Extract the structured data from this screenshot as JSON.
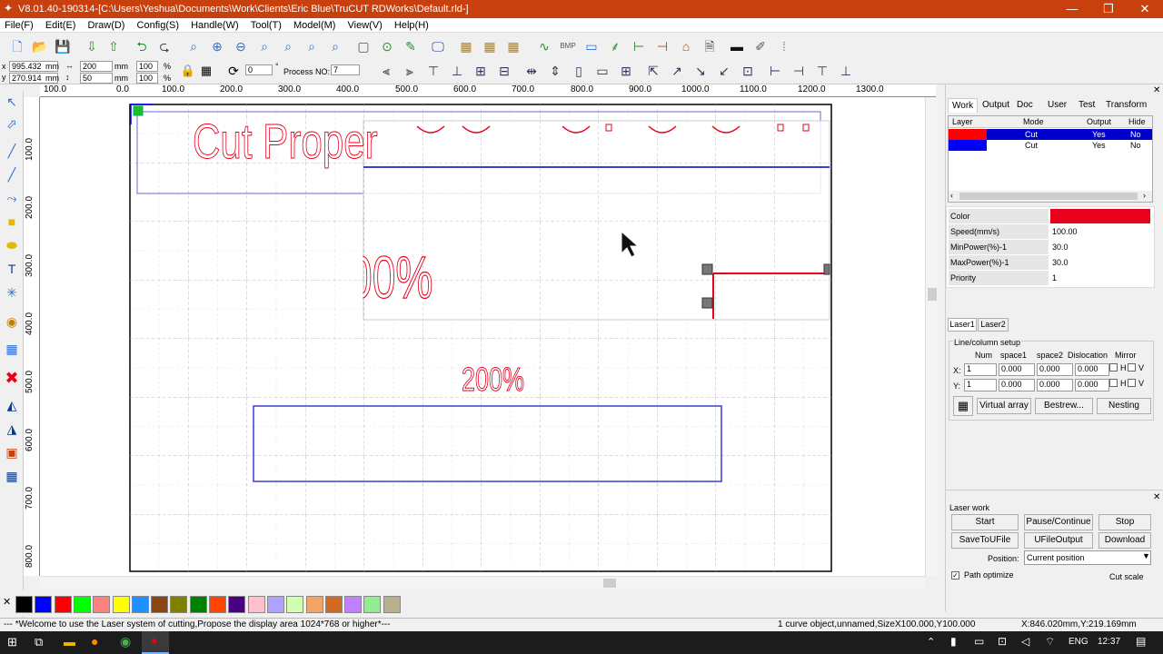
{
  "window": {
    "title": "V8.01.40-190314-[C:\\Users\\Yeshua\\Documents\\Work\\Clients\\Eric Blue\\TruCUT RDWorks\\Default.rld-]",
    "minimize": "—",
    "maximize": "❐",
    "close": "✕"
  },
  "menu": [
    "File(F)",
    "Edit(E)",
    "Draw(D)",
    "Config(S)",
    "Handle(W)",
    "Tool(T)",
    "Model(M)",
    "View(V)",
    "Help(H)"
  ],
  "toolbar2": {
    "x_value": "995.432",
    "y_value": "270.914",
    "x_unit": "mm",
    "y_unit": "mm",
    "width_value": "200",
    "height_value": "50",
    "w_unit": "mm",
    "h_unit": "mm",
    "scale_x": "100",
    "scale_y": "100",
    "pct1": "%",
    "pct2": "%",
    "rotate_value": "0",
    "deg": "°",
    "process_label": "Process NO:",
    "process_value": "7"
  },
  "ruler_h": [
    "100.0",
    "0.0",
    "100.0",
    "200.0",
    "300.0",
    "400.0",
    "500.0",
    "600.0",
    "700.0",
    "800.0",
    "900.0",
    "1000.0",
    "1100.0",
    "1200.0",
    "1300.0"
  ],
  "ruler_v": [
    "100.0",
    "200.0",
    "300.0",
    "400.0",
    "500.0",
    "600.0",
    "700.0",
    "800.0"
  ],
  "canvas": {
    "text_cut_proper": "Cut Proper",
    "text_00pct": "00%",
    "text_200pct": "200%"
  },
  "colors": {
    "accent_red": "#e8001c",
    "accent_blue": "#0000ff",
    "title_bar": "#c9400f",
    "layer_sel": "#0000cc"
  },
  "palette": [
    "#000000",
    "#0000ff",
    "#ff0000",
    "#00ff00",
    "#ff8080",
    "#ffff00",
    "#1e90ff",
    "#8b4513",
    "#808000",
    "#008000",
    "#ff4500",
    "#4b0082",
    "#ffc0cb",
    "#b0a0ff",
    "#d0ffb0",
    "#f4a460",
    "#d2691e",
    "#c080ff",
    "#90ee90",
    "#b8b08c"
  ],
  "panel": {
    "tabs": [
      "Work",
      "Output",
      "Doc",
      "User",
      "Test",
      "Transform"
    ],
    "layer_headers": [
      "Layer",
      "Mode",
      "Output",
      "Hide"
    ],
    "layers": [
      {
        "color": "#ff0000",
        "mode": "Cut",
        "output": "Yes",
        "hide": "No"
      },
      {
        "color": "#0000ff",
        "mode": "Cut",
        "output": "Yes",
        "hide": "No"
      }
    ],
    "props": [
      {
        "label": "Color",
        "value": ""
      },
      {
        "label": "Speed(mm/s)",
        "value": "100.00"
      },
      {
        "label": "MinPower(%)-1",
        "value": "30.0"
      },
      {
        "label": "MaxPower(%)-1",
        "value": "30.0"
      },
      {
        "label": "Priority",
        "value": "1"
      }
    ],
    "laser_tabs": [
      "Laser1",
      "Laser2"
    ],
    "lc_title": "Line/column setup",
    "lc_headers": [
      "Num",
      "space1",
      "space2",
      "Dislocation",
      "Mirror"
    ],
    "lc_x_label": "X:",
    "lc_y_label": "Y:",
    "lc_x": [
      "1",
      "0.000",
      "0.000",
      "0.000"
    ],
    "lc_y": [
      "1",
      "0.000",
      "0.000",
      "0.000"
    ],
    "mirror_h": "H",
    "mirror_v": "V",
    "virtual_array": "Virtual array",
    "bestrew": "Bestrew...",
    "nesting": "Nesting",
    "laser_work": "Laser work",
    "start": "Start",
    "pause": "Pause/Continue",
    "stop": "Stop",
    "save_to_file": "SaveToUFile",
    "ufile_output": "UFileOutput",
    "download": "Download",
    "position_label": "Position:",
    "position_value": "Current position",
    "path_optimize": "Path optimize",
    "cut_scale": "Cut scale"
  },
  "status": {
    "msg": "--- *Welcome to use the Laser system of cutting,Propose the display area 1024*768 or higher*---",
    "object": "1 curve object,unnamed,SizeX100.000,Y100.000",
    "coords": "X:846.020mm,Y:219.169mm"
  },
  "taskbar": {
    "lang": "ENG",
    "time": "12:37"
  }
}
